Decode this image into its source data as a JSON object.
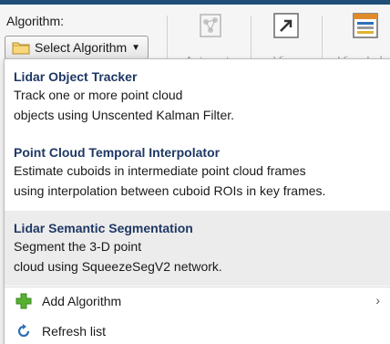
{
  "toolstrip": {
    "algorithm_label": "Algorithm:",
    "select_button_label": "Select Algorithm",
    "tools": [
      {
        "label": "Automate"
      },
      {
        "label": "View"
      },
      {
        "label": "View Labe"
      }
    ]
  },
  "menu": {
    "algorithms": [
      {
        "title": "Lidar Object Tracker",
        "desc_line1": "Track one or more point cloud",
        "desc_line2": "objects using Unscented Kalman Filter."
      },
      {
        "title": "Point Cloud Temporal Interpolator",
        "desc_line1": "Estimate cuboids in intermediate point cloud frames",
        "desc_line2": "using interpolation between cuboid ROIs in key frames."
      },
      {
        "title": "Lidar Semantic Segmentation",
        "desc_line1": "Segment the 3-D point",
        "desc_line2": "cloud using SqueezeSegV2 network."
      }
    ],
    "add_algorithm_label": "Add Algorithm",
    "refresh_list_label": "Refresh list"
  },
  "colors": {
    "title_text": "#1f3864",
    "highlight": "#ececec",
    "add_icon": "#58b030",
    "refresh_icon": "#2f6fb5"
  }
}
